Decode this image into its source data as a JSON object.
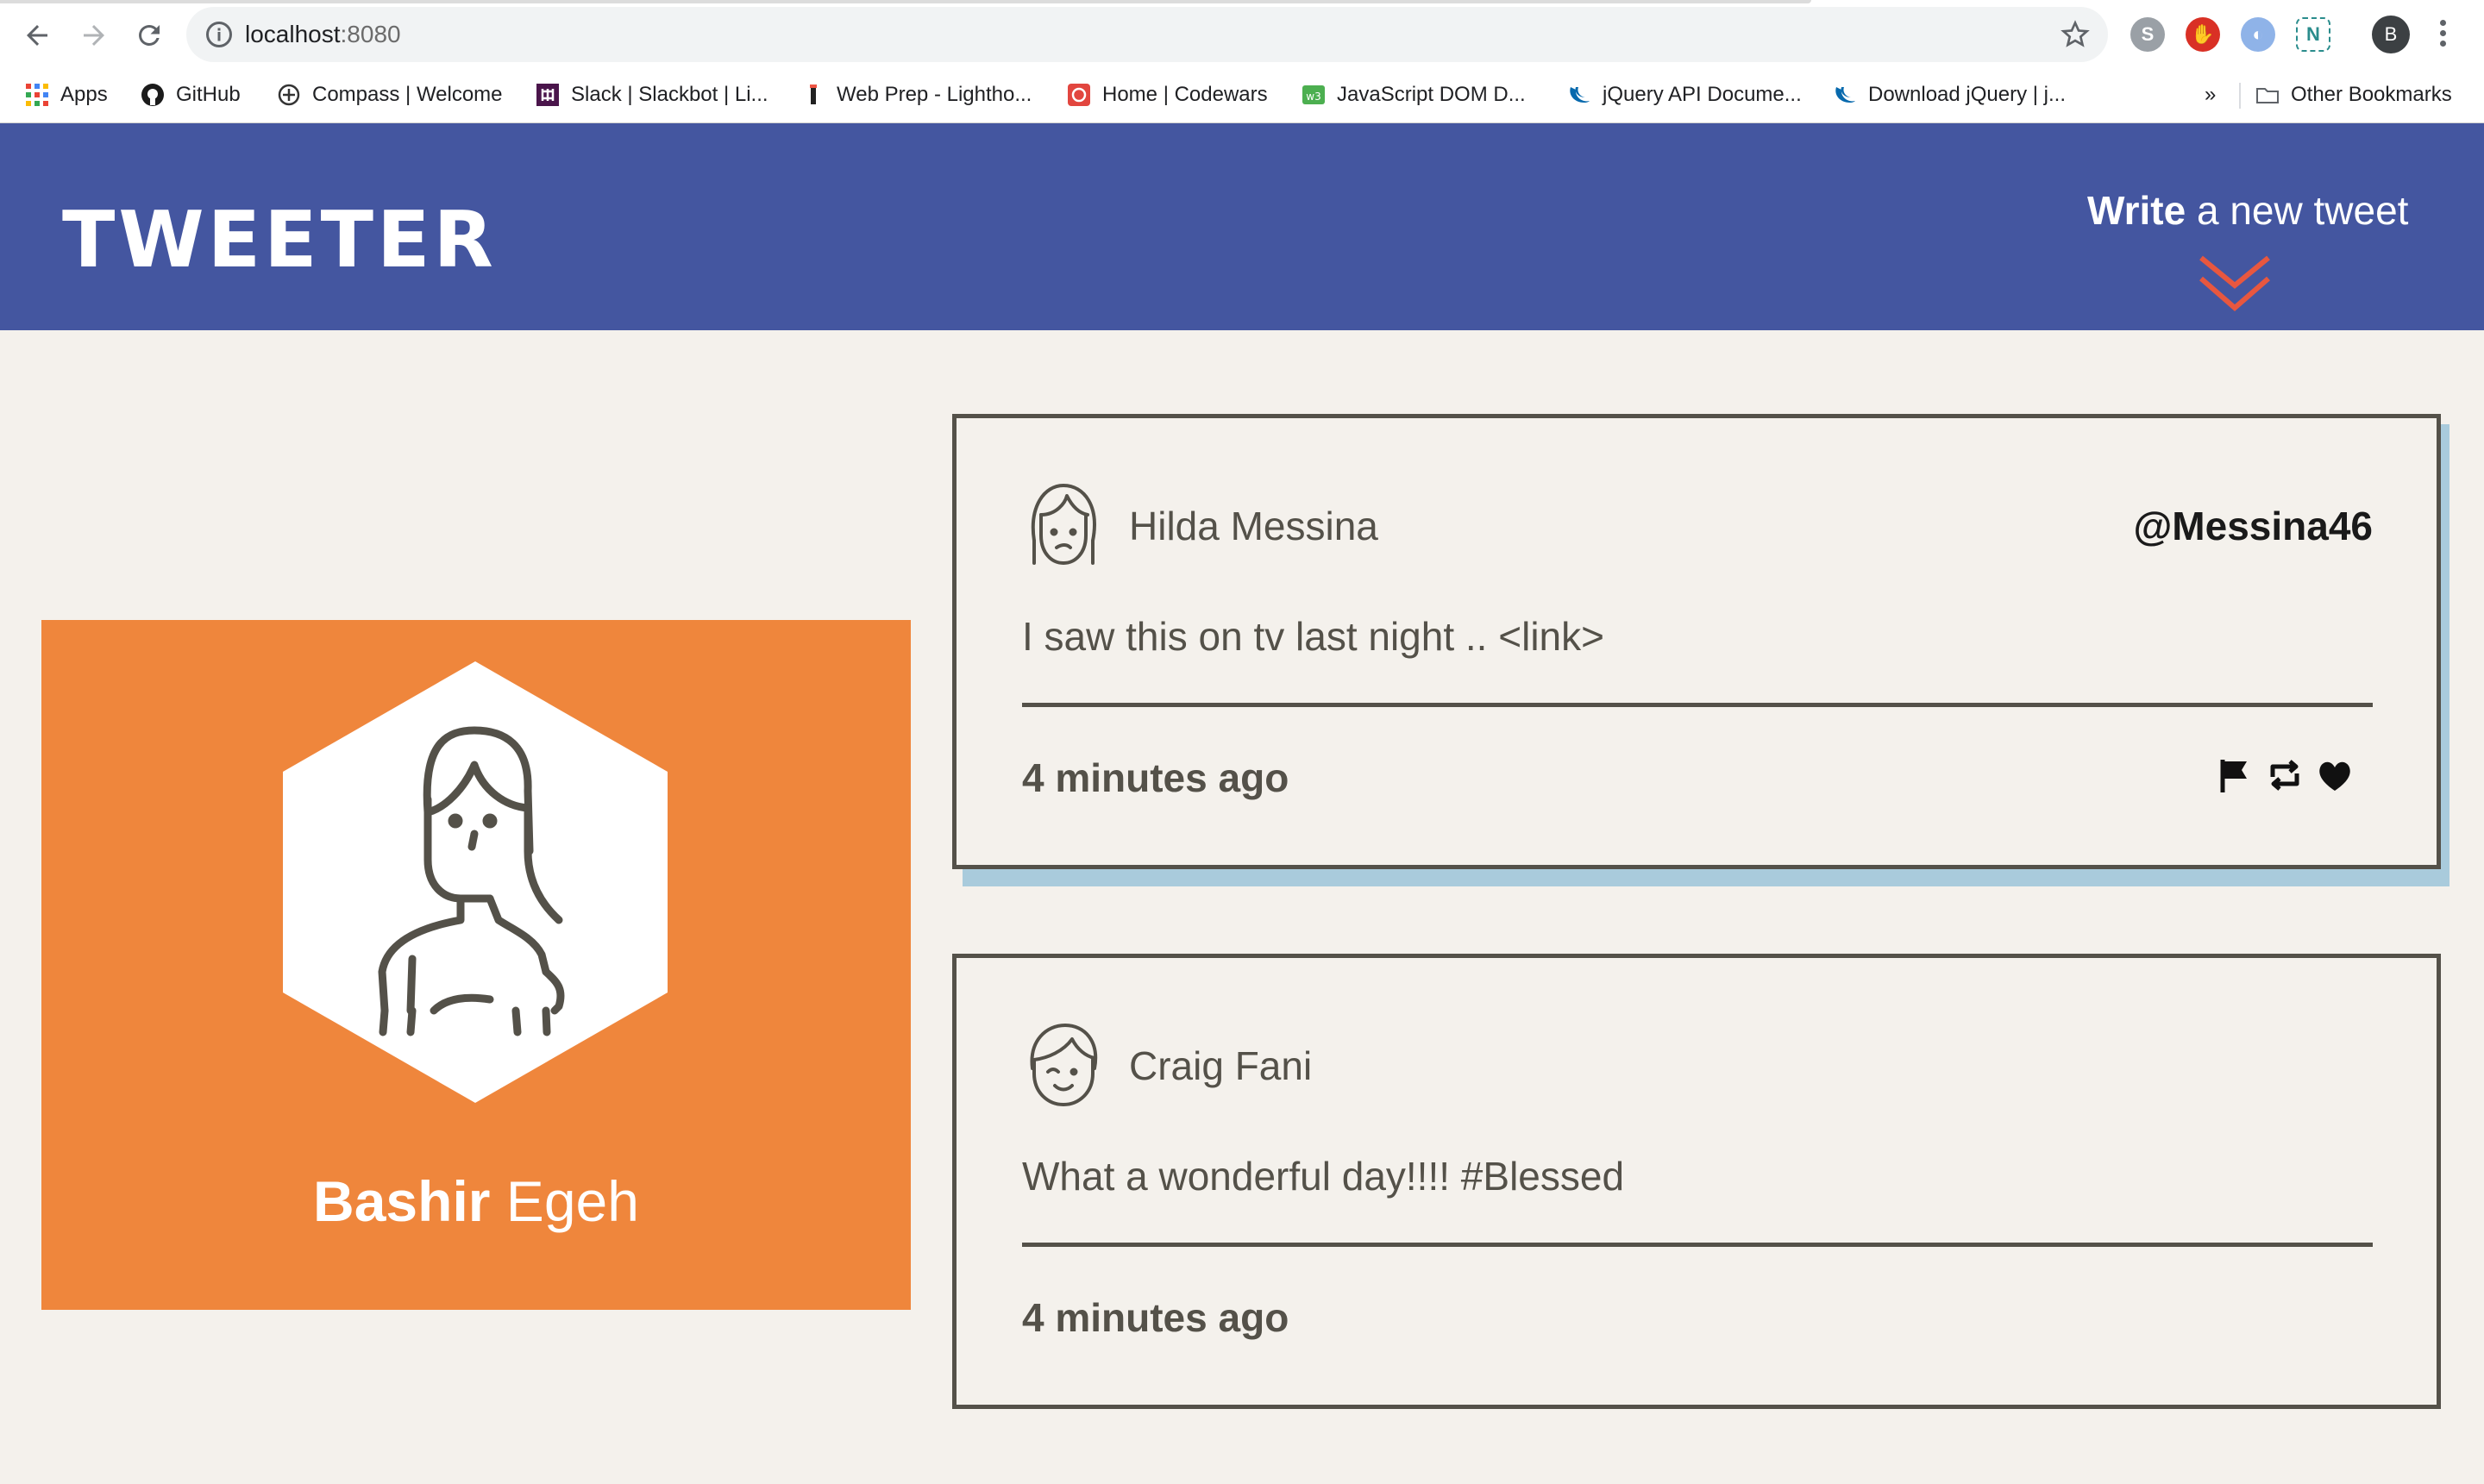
{
  "browser": {
    "url_host": "localhost",
    "url_port": ":8080",
    "profile_initial": "B"
  },
  "bookmarks": {
    "items": [
      {
        "label": "Apps",
        "icon": "apps-grid-icon"
      },
      {
        "label": "GitHub",
        "icon": "github-icon"
      },
      {
        "label": "Compass | Welcome",
        "icon": "compass-icon"
      },
      {
        "label": "Slack | Slackbot | Li...",
        "icon": "slack-icon"
      },
      {
        "label": "Web Prep - Lightho...",
        "icon": "lighthouse-icon"
      },
      {
        "label": "Home | Codewars",
        "icon": "codewars-icon"
      },
      {
        "label": "JavaScript DOM D...",
        "icon": "w3schools-icon"
      },
      {
        "label": "jQuery API Docume...",
        "icon": "jquery-icon"
      },
      {
        "label": "Download jQuery | j...",
        "icon": "jquery-icon"
      }
    ],
    "overflow": "»",
    "other": "Other Bookmarks"
  },
  "header": {
    "logo": "TWEETER",
    "compose_bold": "Write",
    "compose_rest": " a new tweet",
    "colors": {
      "header_bg": "#4456a0",
      "arrow": "#e8573f"
    }
  },
  "profile": {
    "first_name": "Bashir",
    "last_name": " Egeh",
    "card_color": "#ef863c"
  },
  "tweets": [
    {
      "name": "Hilda Messina",
      "handle": "@Messina46",
      "text": "I saw this on tv last night .. <link>",
      "time": "4 minutes ago",
      "avatar": "female-face-avatar-icon",
      "actions": [
        "flag-icon",
        "retweet-icon",
        "heart-icon"
      ]
    },
    {
      "name": "Craig Fani",
      "handle": "",
      "text": "What a wonderful day!!!! #Blessed",
      "time": "4 minutes ago",
      "avatar": "male-face-avatar-icon"
    }
  ]
}
